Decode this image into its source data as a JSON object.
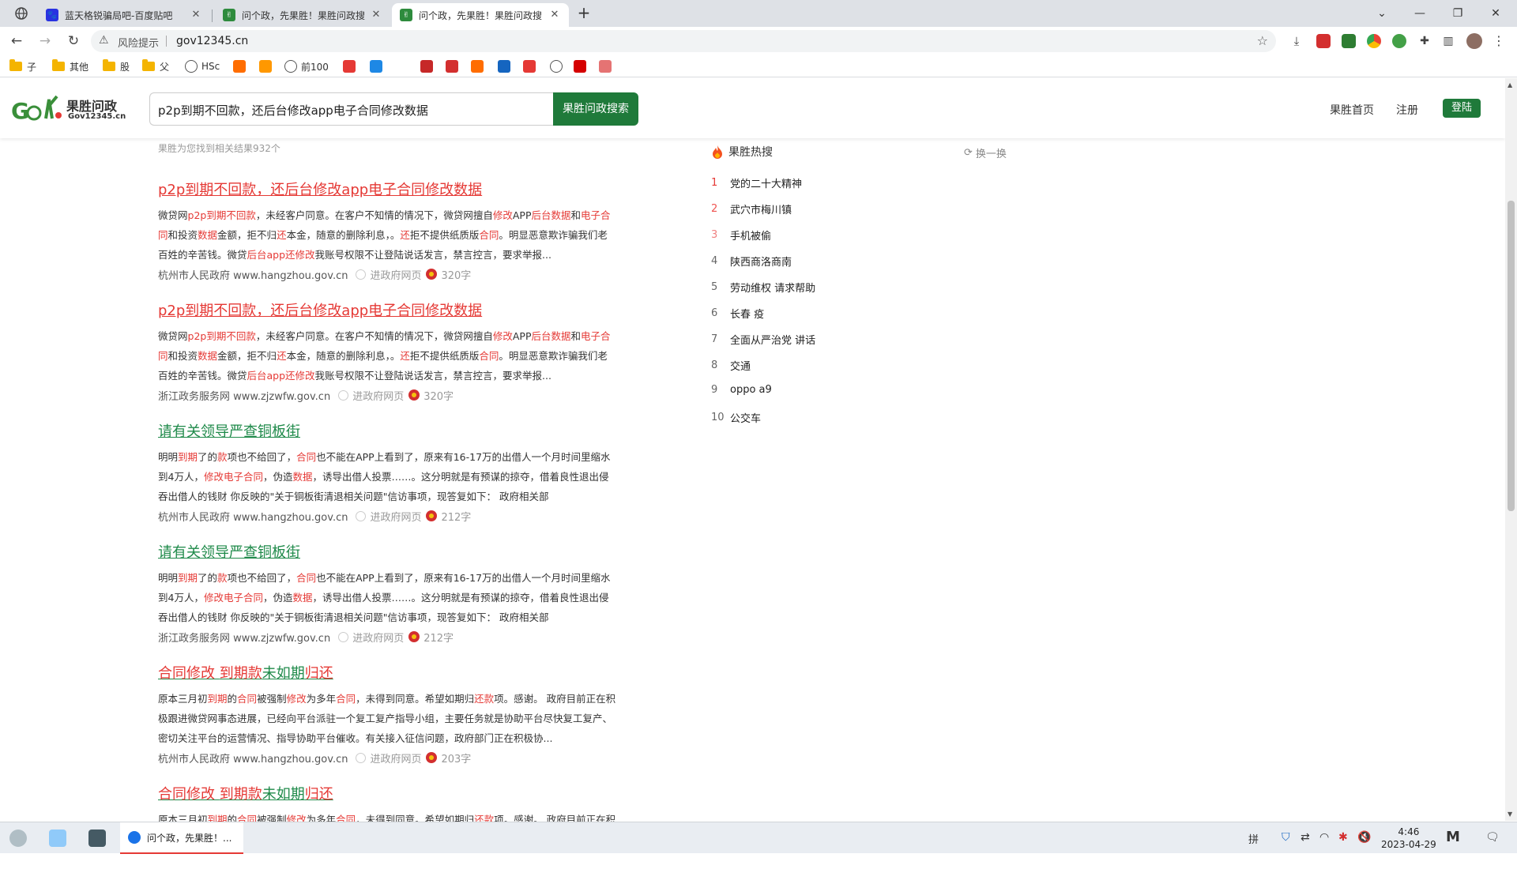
{
  "browser": {
    "tabs": [
      {
        "label": "蓝天格锐骗局吧-百度贴吧",
        "favicon_color": "#2932e1",
        "active": false
      },
      {
        "label": "问个政，先果胜！果胜问政搜",
        "favicon_color": "#2e8b3d",
        "active": false
      },
      {
        "label": "问个政，先果胜！果胜问政搜",
        "favicon_color": "#2e8b3d",
        "active": true
      }
    ],
    "new_tab": "+",
    "address": {
      "risk_label": "风险提示",
      "url": "gov12345.cn"
    },
    "bookmarks": [
      {
        "label": "子",
        "type": "folder"
      },
      {
        "label": "其他",
        "type": "folder"
      },
      {
        "label": "股",
        "type": "folder"
      },
      {
        "label": "父",
        "type": "folder"
      },
      {
        "label": "HSc",
        "type": "globe"
      },
      {
        "label": "",
        "type": "icon",
        "color": "#ff6d00"
      },
      {
        "label": "",
        "type": "icon",
        "color": "#ff9800"
      },
      {
        "label": "前100",
        "type": "globe"
      },
      {
        "label": "",
        "type": "icon",
        "color": "#e53935"
      },
      {
        "label": "",
        "type": "icon",
        "color": "#1e88e5"
      },
      {
        "label": "",
        "type": "icon",
        "color": "#c62828"
      },
      {
        "label": "",
        "type": "icon",
        "color": "#d32f2f"
      },
      {
        "label": "",
        "type": "icon",
        "color": "#ff6d00"
      },
      {
        "label": "",
        "type": "icon",
        "color": "#1565c0"
      },
      {
        "label": "",
        "type": "icon",
        "color": "#e53935"
      },
      {
        "label": "",
        "type": "globe"
      },
      {
        "label": "",
        "type": "icon",
        "color": "#d50000"
      },
      {
        "label": "",
        "type": "icon",
        "color": "#e57373"
      }
    ]
  },
  "site": {
    "logo_name": "果胜问政",
    "logo_domain": "Gov12345.cn",
    "search_query": "p2p到期不回款，还后台修改app电子合同修改数据",
    "search_button": "果胜问政搜索",
    "nav": {
      "home": "果胜首页",
      "register": "注册",
      "login": "登陆"
    }
  },
  "results": {
    "count_text": "果胜为您找到相关结果932个",
    "items": [
      {
        "title": "p2p到期不回款，还后台修改app电子合同修改数据",
        "title_style": "red",
        "body_html": "微贷网<span class=\"hl\">p2p到期不回款</span>，未经客户同意。在客户不知情的情况下，微贷网擅自<span class=\"hl\">修改</span>APP<span class=\"hl\">后台数据</span>和<span class=\"hl\">电子合同</span>和投资<span class=\"hl\">数据</span>金额，拒不归<span class=\"hl\">还</span>本金，随意的删除利息，。<span class=\"hl\">还</span>拒不提供纸质版<span class=\"hl\">合同</span>。明显恶意欺诈骗我们老百姓的辛苦钱。微贷<span class=\"hl\">后台app还修改</span>我账号权限不让登陆说话发言，禁言控言，要求举报...",
        "source": "杭州市人民政府 www.hangzhou.gov.cn",
        "type": "进政府网页",
        "words": "320字"
      },
      {
        "title": "p2p到期不回款，还后台修改app电子合同修改数据",
        "title_style": "red",
        "body_html": "微贷网<span class=\"hl\">p2p到期不回款</span>，未经客户同意。在客户不知情的情况下，微贷网擅自<span class=\"hl\">修改</span>APP<span class=\"hl\">后台数据</span>和<span class=\"hl\">电子合同</span>和投资<span class=\"hl\">数据</span>金额，拒不归<span class=\"hl\">还</span>本金，随意的删除利息，。<span class=\"hl\">还</span>拒不提供纸质版<span class=\"hl\">合同</span>。明显恶意欺诈骗我们老百姓的辛苦钱。微贷<span class=\"hl\">后台app还修改</span>我账号权限不让登陆说话发言，禁言控言，要求举报...",
        "source": "浙江政务服务网 www.zjzwfw.gov.cn",
        "type": "进政府网页",
        "words": "320字"
      },
      {
        "title": "请有关领导严查铜板街",
        "title_style": "green",
        "body_html": "明明<span class=\"hl\">到期</span>了的<span class=\"hl\">款</span>项也不给回了，<span class=\"hl\">合同</span>也不能在APP上看到了，原来有16-17万的出借人一个月时间里缩水到4万人，<span class=\"hl\">修改电子合同</span>，伪造<span class=\"hl\">数据</span>，诱导出借人投票……。这分明就是有预谋的掠夺，借着良性退出侵吞出借人的钱财 你反映的\"关于铜板街清退相关问题\"信访事项，现答复如下： 政府相关部",
        "source": "杭州市人民政府 www.hangzhou.gov.cn",
        "type": "进政府网页",
        "words": "212字"
      },
      {
        "title": "请有关领导严查铜板街",
        "title_style": "green",
        "body_html": "明明<span class=\"hl\">到期</span>了的<span class=\"hl\">款</span>项也不给回了，<span class=\"hl\">合同</span>也不能在APP上看到了，原来有16-17万的出借人一个月时间里缩水到4万人，<span class=\"hl\">修改电子合同</span>，伪造<span class=\"hl\">数据</span>，诱导出借人投票……。这分明就是有预谋的掠夺，借着良性退出侵吞出借人的钱财 你反映的\"关于铜板街清退相关问题\"信访事项，现答复如下： 政府相关部",
        "source": "浙江政务服务网 www.zjzwfw.gov.cn",
        "type": "进政府网页",
        "words": "212字"
      },
      {
        "title": "合同修改 到期款未如期归还",
        "title_style": "mixed",
        "body_html": "原本三月初<span class=\"hl\">到期</span>的<span class=\"hl\">合同</span>被强制<span class=\"hl\">修改</span>为多年<span class=\"hl\">合同</span>，未得到同意。希望如期归<span class=\"hl\">还款</span>项。感谢。 政府目前正在积极跟进微贷网事态进展，已经向平台派驻一个复工复产指导小组，主要任务就是协助平台尽快复工复产、密切关注平台的运营情况、指导协助平台催收。有关接入征信问题，政府部门正在积极协...",
        "source": "杭州市人民政府 www.hangzhou.gov.cn",
        "type": "进政府网页",
        "words": "203字"
      },
      {
        "title": "合同修改 到期款未如期归还",
        "title_style": "mixed",
        "body_html": "原本三月初<span class=\"hl\">到期</span>的<span class=\"hl\">合同</span>被强制<span class=\"hl\">修改</span>为多年<span class=\"hl\">合同</span>，未得到同意。希望如期归<span class=\"hl\">还款</span>项。感谢。 政府目前正在积极跟进微贷网事态进展",
        "source": "",
        "type": "",
        "words": ""
      }
    ]
  },
  "hot": {
    "title": "果胜热搜",
    "refresh": "换一换",
    "items": [
      {
        "rank": "1",
        "text": "党的二十大精神"
      },
      {
        "rank": "2",
        "text": "武穴市梅川镇"
      },
      {
        "rank": "3",
        "text": "手机被偷"
      },
      {
        "rank": "4",
        "text": "陕西商洛商南"
      },
      {
        "rank": "5",
        "text": "劳动维权 请求帮助"
      },
      {
        "rank": "6",
        "text": "长春 疫"
      },
      {
        "rank": "7",
        "text": "全面从严治党 讲话"
      },
      {
        "rank": "8",
        "text": "交通"
      },
      {
        "rank": "9",
        "text": "oppo a9"
      },
      {
        "rank": "10",
        "text": "公交车"
      }
    ]
  },
  "taskbar": {
    "active_app": "问个政，先果胜！...",
    "input_method": "拼",
    "time": "4:46",
    "date": "2023-04-29"
  },
  "colors": {
    "brand_green": "#1f7a3a",
    "highlight_red": "#e53935"
  }
}
